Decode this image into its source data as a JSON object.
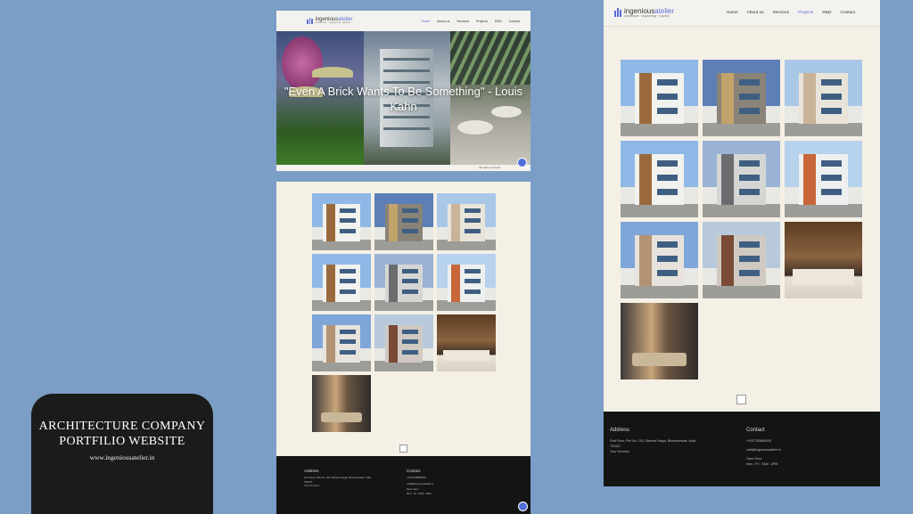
{
  "brand": {
    "logo_main": "ingenious",
    "logo_accent": "atelier",
    "tagline": "architecture · engineering · property",
    "accent_color": "#5b6fd6"
  },
  "hero_site": {
    "menu": [
      "Home",
      "About us",
      "Services",
      "Projects",
      "R&D",
      "Contact"
    ],
    "active_menu": "Home",
    "quote": "\"Even A Brick Wants To Be Something\" - Louis Kahn",
    "copyright": "All rights reserved"
  },
  "right_site": {
    "menu": [
      "Home",
      "About us",
      "Services",
      "Projects",
      "R&D",
      "Contact"
    ],
    "active_menu": "Projects"
  },
  "footer": {
    "address_title": "Address",
    "address_line1": "First Floor, Plot No. 153, Saheed Nagar, Bhubaneswar, India",
    "address_line2": "751007",
    "address_extra": "Your Services",
    "contact_title": "Contact",
    "phone": "+9107765889000",
    "email": "mail@ingeniousatelier.in",
    "hours_title": "Open Hour",
    "hours": "Mon - Fri : 9AM - 6PM"
  },
  "gallery": [
    {
      "kind": "house-white-wood",
      "sky": "#8fb8e6"
    },
    {
      "kind": "house-night",
      "sky": "#5d7fb7"
    },
    {
      "kind": "house-wide",
      "sky": "#a9c8e8"
    },
    {
      "kind": "house-white-wood",
      "sky": "#8fb8e6"
    },
    {
      "kind": "house-grey",
      "sky": "#9ab3d6"
    },
    {
      "kind": "house-orange",
      "sky": "#b7d2ec"
    },
    {
      "kind": "house-palm",
      "sky": "#7ea6d9"
    },
    {
      "kind": "house-slats",
      "sky": "#b8c9dc"
    },
    {
      "kind": "bedroom-wood",
      "sky": "#6b4a2f"
    },
    {
      "kind": "interior-lounge",
      "sky": "#7a5a3a"
    }
  ],
  "title_card": {
    "title_line1": "ARCHITECTURE  COMPANY",
    "title_line2": "PORTFILIO WEBSITE",
    "url": "www.ingeniousatelier.in"
  }
}
